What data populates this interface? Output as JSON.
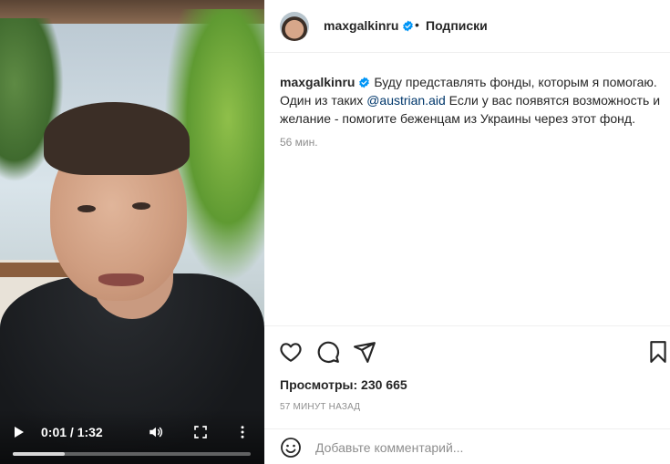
{
  "video": {
    "time_display": "0:01 / 1:32",
    "progress_fraction": 0.22,
    "icons": [
      "play-icon",
      "volume-icon",
      "fullscreen-icon",
      "more-vertical-icon"
    ]
  },
  "header": {
    "username": "maxgalkinru",
    "separator": "•",
    "follow_label": "Подписки"
  },
  "caption": {
    "username": "maxgalkinru",
    "text_before": "Буду представлять фонды, которым я помогаю. Один из таких ",
    "mention": "@austrian.aid",
    "text_after": " Если у вас появятся возможность и желание - помогите беженцам из Украины через этот фонд.",
    "time": "56 мин."
  },
  "actions": {
    "icons": [
      "heart-icon",
      "comment-icon",
      "share-icon",
      "bookmark-icon"
    ],
    "views": "Просмотры: 230 665",
    "posted_ago": "57 МИНУТ НАЗАД"
  },
  "comment_box": {
    "placeholder": "Добавьте комментарий..."
  },
  "colors": {
    "verified_blue": "#0095f6",
    "mention_blue": "#00376b",
    "muted_gray": "#8e8e8e",
    "text": "#262626"
  }
}
